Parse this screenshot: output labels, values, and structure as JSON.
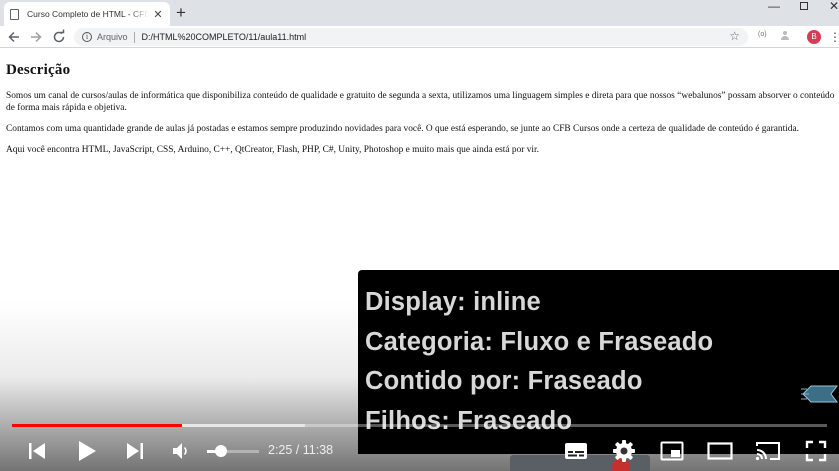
{
  "browser": {
    "tab_title": "Curso Completo de HTML - CFB Cursos",
    "tab_close": "✕",
    "new_tab": "+",
    "window_min": "—",
    "window_close": "✕",
    "address_chip": "Arquivo",
    "address_url": "D:/HTML%20COMPLETO/11/aula11.html",
    "profile_initial": "B",
    "extension_label": "(o)",
    "icons": [
      "file-icon",
      "back-icon",
      "forward-icon",
      "reload-icon",
      "info-icon",
      "star-icon",
      "profile-icon",
      "menu-icon"
    ]
  },
  "page": {
    "heading": "Descrição",
    "paragraphs": [
      "Somos um canal de cursos/aulas de informática que disponibiliza conteúdo de qualidade e gratuito de segunda a sexta, utilizamos uma linguagem simples e direta para que nossos “webalunos” possam absorver o conteúdo de forma mais rápida e objetiva.",
      "Contamos com uma quantidade grande de aulas já postadas e estamos sempre produzindo novidades para você. O que está esperando, se junte ao CFB Cursos onde a certeza de qualidade de conteúdo é garantida.",
      "Aqui você encontra HTML, JavaScript, CSS, Arduino, C++, QtCreator, Flash, PHP, C#, Unity, Photoshop e muito mais que ainda está por vir."
    ]
  },
  "overlay": {
    "lines": [
      "Display: inline",
      "Categoria: Fluxo e Fraseado",
      "Contido por: Fraseado",
      "Filhos: Fraseado"
    ],
    "logo_text": "CFB"
  },
  "player": {
    "time_display": "2:25 / 11:38",
    "played_fraction": 0.208,
    "buffered_fraction": 0.36,
    "volume_fraction": 0.25,
    "colors": {
      "progress": "#ff0000",
      "controls": "#ffffff"
    },
    "icons": [
      "previous-icon",
      "play-icon",
      "next-icon",
      "volume-icon",
      "captions-icon",
      "settings-icon",
      "miniplayer-icon",
      "theater-icon",
      "cast-icon",
      "fullscreen-icon"
    ]
  }
}
